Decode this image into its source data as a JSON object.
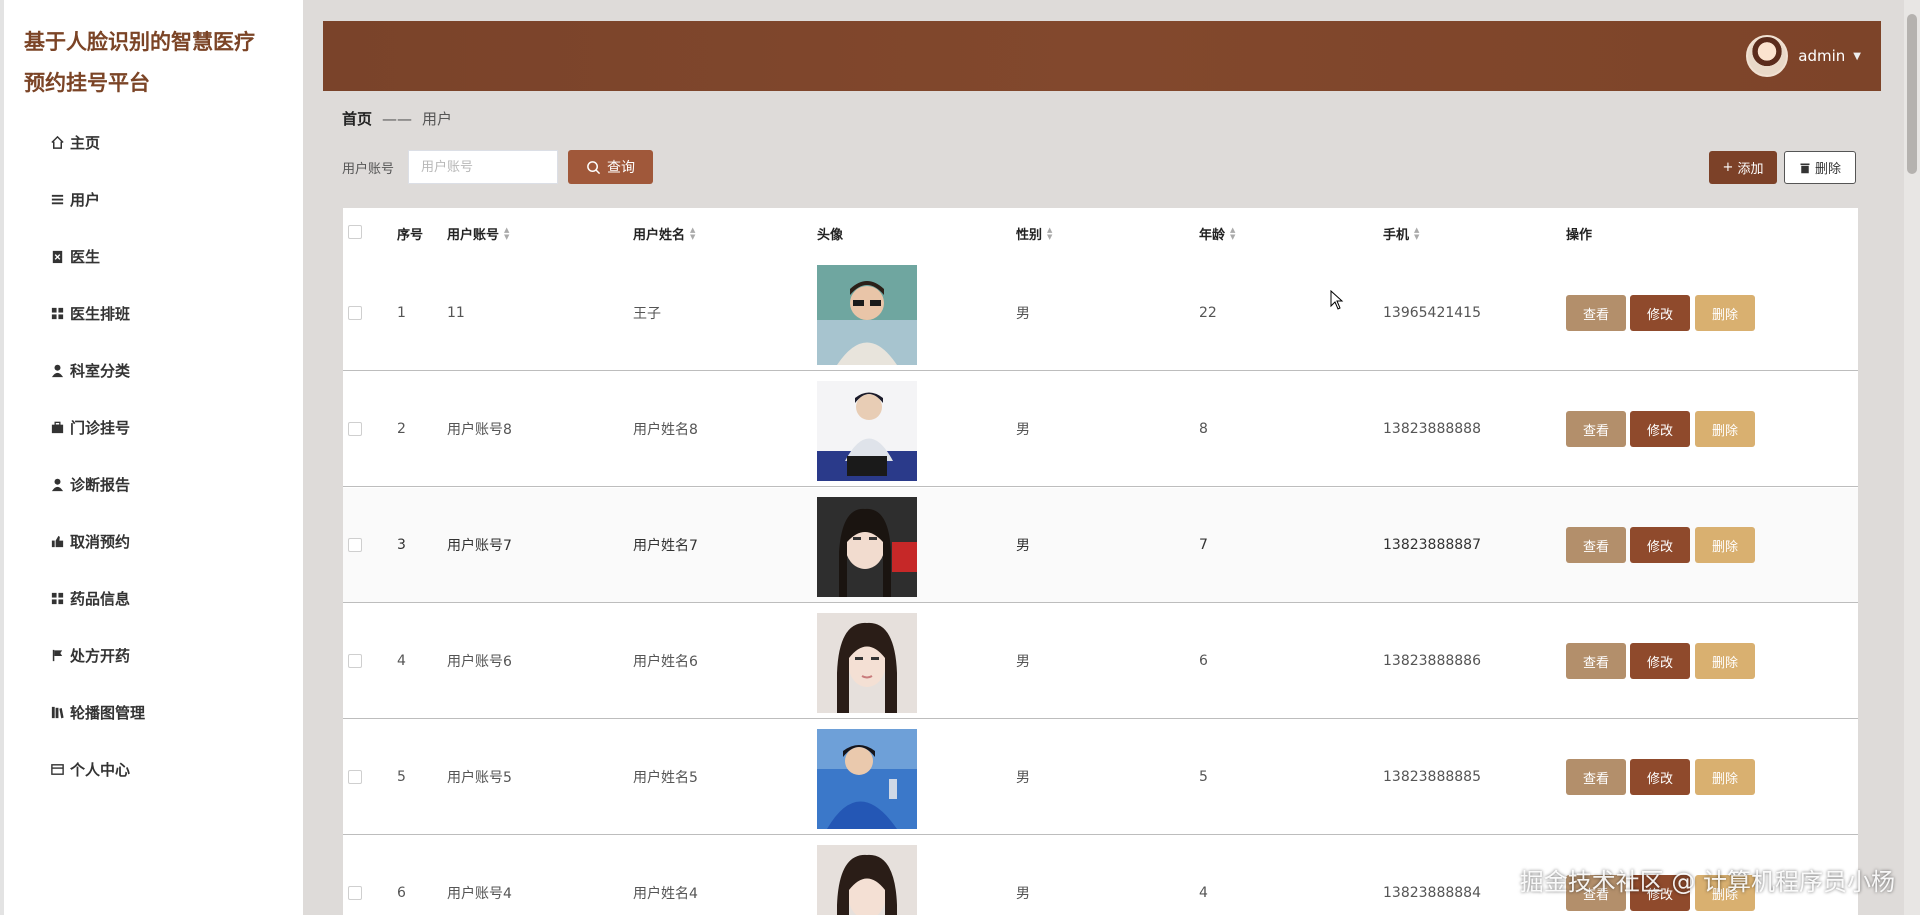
{
  "brand": {
    "line1": "基于人脸识别的智慧医疗",
    "line2": "预约挂号平台"
  },
  "sidebar": {
    "items": [
      {
        "label": "主页",
        "icon": "home-icon"
      },
      {
        "label": "用户",
        "icon": "list-icon"
      },
      {
        "label": "医生",
        "icon": "clipboard-icon"
      },
      {
        "label": "医生排班",
        "icon": "grid-icon"
      },
      {
        "label": "科室分类",
        "icon": "user-icon"
      },
      {
        "label": "门诊挂号",
        "icon": "briefcase-icon"
      },
      {
        "label": "诊断报告",
        "icon": "person-icon"
      },
      {
        "label": "取消预约",
        "icon": "thumb-icon"
      },
      {
        "label": "药品信息",
        "icon": "grid-icon"
      },
      {
        "label": "处方开药",
        "icon": "flag-icon"
      },
      {
        "label": "轮播图管理",
        "icon": "library-icon"
      },
      {
        "label": "个人中心",
        "icon": "card-icon"
      }
    ]
  },
  "header": {
    "username": "admin"
  },
  "breadcrumb": {
    "home": "首页",
    "sep": "——",
    "current": "用户"
  },
  "search": {
    "label": "用户账号",
    "placeholder": "用户账号",
    "button": "查询"
  },
  "toolbar": {
    "add": "添加",
    "delete": "删除"
  },
  "table": {
    "headers": {
      "index": "序号",
      "account": "用户账号",
      "name": "用户姓名",
      "avatar": "头像",
      "gender": "性别",
      "age": "年龄",
      "phone": "手机",
      "actions": "操作"
    },
    "rows": [
      {
        "index": "1",
        "account": "11",
        "name": "王子",
        "gender": "男",
        "age": "22",
        "phone": "13965421415"
      },
      {
        "index": "2",
        "account": "用户账号8",
        "name": "用户姓名8",
        "gender": "男",
        "age": "8",
        "phone": "13823888888"
      },
      {
        "index": "3",
        "account": "用户账号7",
        "name": "用户姓名7",
        "gender": "男",
        "age": "7",
        "phone": "13823888887"
      },
      {
        "index": "4",
        "account": "用户账号6",
        "name": "用户姓名6",
        "gender": "男",
        "age": "6",
        "phone": "13823888886"
      },
      {
        "index": "5",
        "account": "用户账号5",
        "name": "用户姓名5",
        "gender": "男",
        "age": "5",
        "phone": "13823888885"
      },
      {
        "index": "6",
        "account": "用户账号4",
        "name": "用户姓名4",
        "gender": "男",
        "age": "4",
        "phone": "13823888884"
      }
    ],
    "action_labels": {
      "view": "查看",
      "edit": "修改",
      "delete": "删除"
    }
  },
  "watermark": "掘金技术社区 @ 计算机程序员小杨",
  "colors": {
    "primary": "#7c4128",
    "accent": "#a0583a",
    "view": "#b38f6b",
    "edit": "#8f4a2c",
    "del": "#d9b070"
  }
}
